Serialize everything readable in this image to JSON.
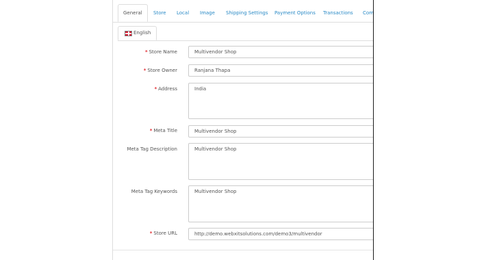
{
  "tabs": [
    {
      "label": "General"
    },
    {
      "label": "Store"
    },
    {
      "label": "Local"
    },
    {
      "label": "Image"
    },
    {
      "label": "Shipping Settings"
    },
    {
      "label": "Payment Options"
    },
    {
      "label": "Transactions"
    },
    {
      "label": "Com"
    }
  ],
  "language_tab": {
    "label": "English",
    "icon": "uk-flag-icon"
  },
  "form": {
    "store_name": {
      "label": "Store Name",
      "required": true,
      "value": "Multivendor Shop"
    },
    "store_owner": {
      "label": "Store Owner",
      "required": true,
      "value": "Ranjana Thapa"
    },
    "address": {
      "label": "Address",
      "required": true,
      "value": "India"
    },
    "meta_title": {
      "label": "Meta Title",
      "required": true,
      "value": "Multivendor Shop"
    },
    "meta_tag_description": {
      "label": "Meta Tag Description",
      "required": false,
      "value": "Multivendor Shop"
    },
    "meta_tag_keywords": {
      "label": "Meta Tag Keywords",
      "required": false,
      "value": "Multivendor Shop"
    },
    "store_url": {
      "label": "Store URL",
      "required": true,
      "value": "http://demo.webxitsolutions.com/demo3/multivendor"
    }
  },
  "colors": {
    "link": "#2a8ac6",
    "required": "#e2272d",
    "border": "#cccccc"
  }
}
